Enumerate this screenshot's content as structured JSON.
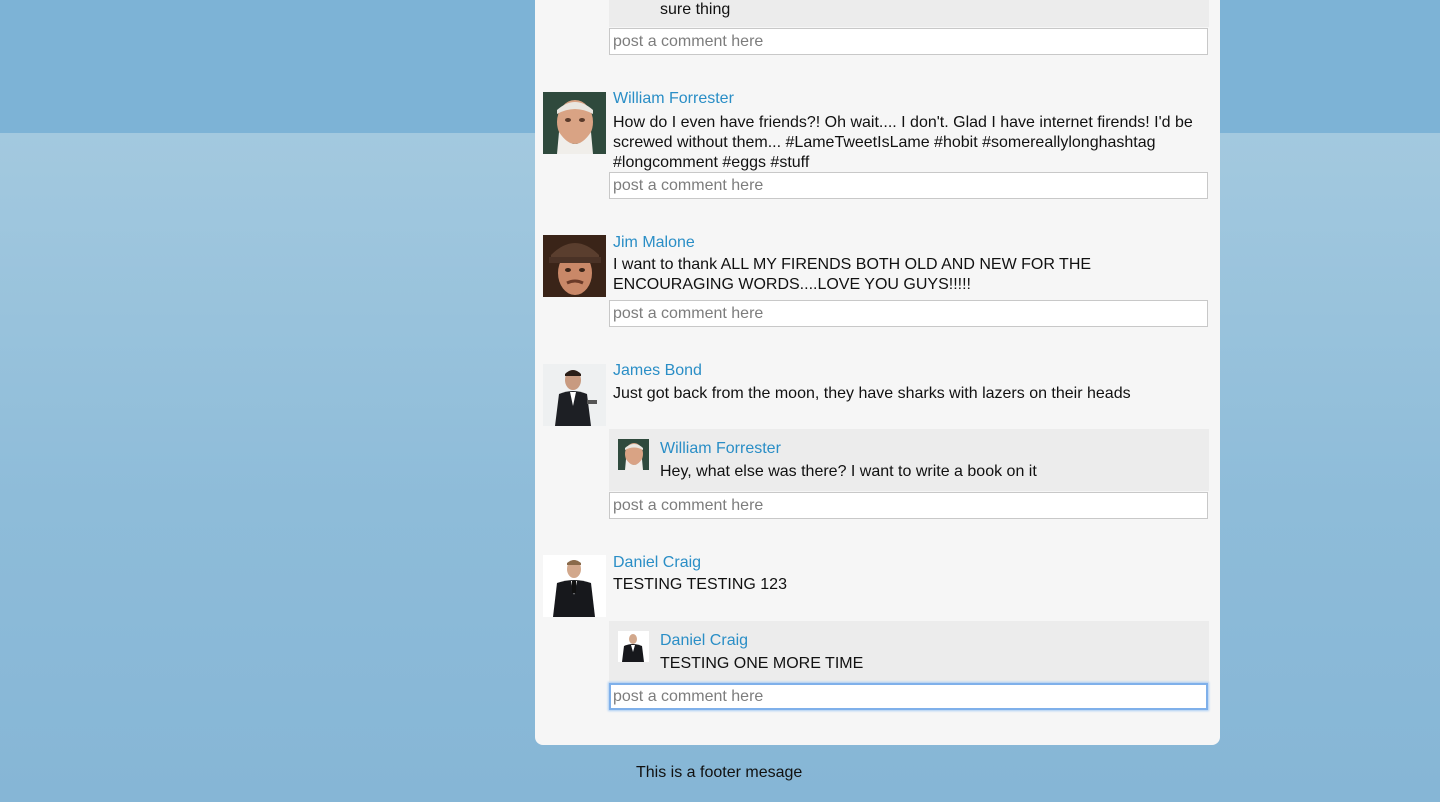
{
  "colors": {
    "link": "#2a8ec6",
    "feed_background": "#f6f6f6",
    "reply_background": "#ececec",
    "page_background": "#85b7d7"
  },
  "comment_placeholder": "post a comment here",
  "top_partial": {
    "reply_text": "sure thing"
  },
  "posts": [
    {
      "author": "William Forrester",
      "avatar": "william-forrester-avatar",
      "text": "How do I even have friends?! Oh wait.... I don't. Glad I have internet firends! I'd be screwed without them... #LameTweetIsLame #hobit #somereallylonghashtag #longcomment #eggs #stuff"
    },
    {
      "author": "Jim Malone",
      "avatar": "jim-malone-avatar",
      "text": "I want to thank ALL MY FIRENDS BOTH OLD AND NEW FOR THE ENCOURAGING WORDS....LOVE YOU GUYS!!!!!"
    },
    {
      "author": "James Bond",
      "avatar": "james-bond-avatar",
      "text": "Just got back from the moon, they have sharks with lazers on their heads",
      "reply": {
        "author": "William Forrester",
        "text": "Hey, what else was there? I want to write a book on it"
      }
    },
    {
      "author": "Daniel Craig",
      "avatar": "daniel-craig-avatar",
      "text": "TESTING TESTING 123",
      "reply": {
        "author": "Daniel Craig",
        "text": "TESTING ONE MORE TIME"
      }
    }
  ],
  "footer": "This is a footer mesage"
}
